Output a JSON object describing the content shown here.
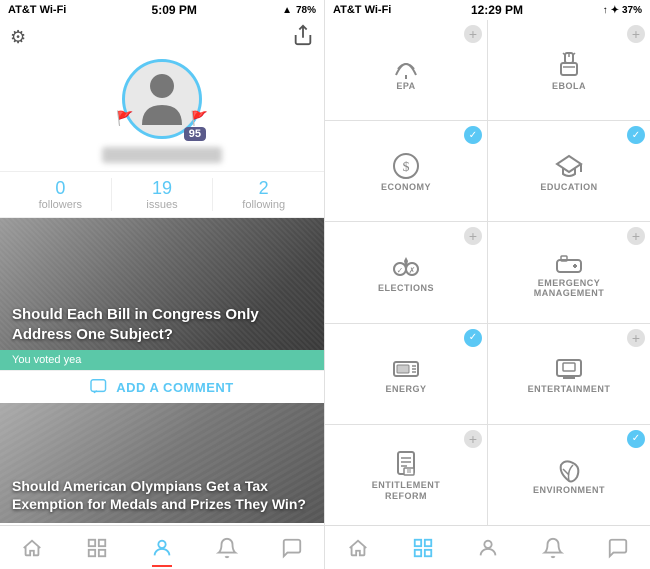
{
  "left": {
    "statusBar": {
      "carrier": "AT&T Wi-Fi",
      "wifi": "wifi",
      "time": "5:09 PM",
      "battery_pct": "78%",
      "battery_icon": "🔋"
    },
    "profile": {
      "score": "95",
      "username_placeholder": "username"
    },
    "stats": [
      {
        "value": "0",
        "label": "followers"
      },
      {
        "value": "19",
        "label": "issues"
      },
      {
        "value": "2",
        "label": "following"
      }
    ],
    "cards": [
      {
        "title": "Should Each Bill in Congress Only Address One Subject?",
        "voted": "You voted yea",
        "add_comment": "ADD A COMMENT"
      },
      {
        "title": "Should American Olympians Get a Tax Exemption for Medals and Prizes They Win?"
      }
    ],
    "nav": [
      {
        "icon": "house",
        "label": "home",
        "active": false
      },
      {
        "icon": "grid",
        "label": "topics",
        "active": false
      },
      {
        "icon": "person",
        "label": "profile",
        "active": true
      },
      {
        "icon": "bell",
        "label": "notifications",
        "active": false
      },
      {
        "icon": "bubble",
        "label": "messages",
        "active": false
      }
    ]
  },
  "right": {
    "statusBar": {
      "carrier": "AT&T Wi-Fi",
      "wifi": "wifi",
      "time": "12:29 PM",
      "bluetooth": "B",
      "battery_pct": "37%"
    },
    "topics": [
      {
        "id": "epa",
        "label": "EPA",
        "checked": false,
        "plus": false
      },
      {
        "id": "ebola",
        "label": "EBOLA",
        "checked": false,
        "plus": false
      },
      {
        "id": "economy",
        "label": "ECONOMY",
        "checked": true,
        "plus": false
      },
      {
        "id": "education",
        "label": "EDUCATION",
        "checked": true,
        "plus": false
      },
      {
        "id": "elections",
        "label": "ELECTIONS",
        "checked": false,
        "plus": false
      },
      {
        "id": "emergency-mgmt",
        "label": "EMERGENCY\nMANAGEMENT",
        "checked": false,
        "plus": true
      },
      {
        "id": "energy",
        "label": "ENERGY",
        "checked": true,
        "plus": false
      },
      {
        "id": "entertainment",
        "label": "ENTERTAINMENT",
        "checked": false,
        "plus": true
      },
      {
        "id": "entitlement-reform",
        "label": "ENTITLEMENT\nREFORM",
        "checked": false,
        "plus": true
      },
      {
        "id": "environment",
        "label": "ENVIRONMENT",
        "checked": true,
        "plus": false
      }
    ],
    "nav": [
      {
        "icon": "house",
        "label": "home",
        "active": false
      },
      {
        "icon": "grid",
        "label": "topics",
        "active": true
      },
      {
        "icon": "person",
        "label": "profile",
        "active": false
      },
      {
        "icon": "bell",
        "label": "notifications",
        "active": false
      },
      {
        "icon": "bubble",
        "label": "messages",
        "active": false
      }
    ]
  }
}
